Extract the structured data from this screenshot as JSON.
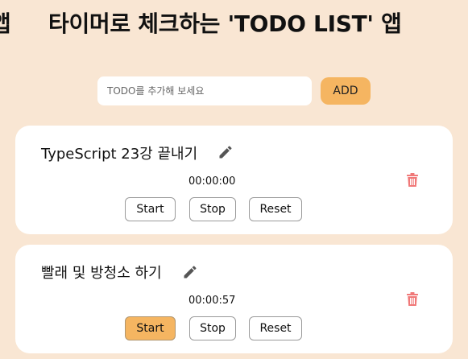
{
  "header": {
    "title_cut": "앱",
    "title": "타이머로 체크하는 'TODO LIST' 앱"
  },
  "add_form": {
    "placeholder": "TODO를 추가해 보세요",
    "button_label": "ADD"
  },
  "todos": [
    {
      "text": "TypeScript 23강 끝내기",
      "timer": "00:00:00",
      "start_label": "Start",
      "stop_label": "Stop",
      "reset_label": "Reset",
      "running": false
    },
    {
      "text": "빨래 및 방청소 하기",
      "timer": "00:00:57",
      "start_label": "Start",
      "stop_label": "Stop",
      "reset_label": "Reset",
      "running": true
    }
  ],
  "colors": {
    "background": "#f9e6d3",
    "accent": "#f5b561",
    "delete_icon": "#f07878",
    "edit_icon": "#555555"
  },
  "icons": {
    "edit": "edit-icon",
    "delete": "trash-icon"
  }
}
